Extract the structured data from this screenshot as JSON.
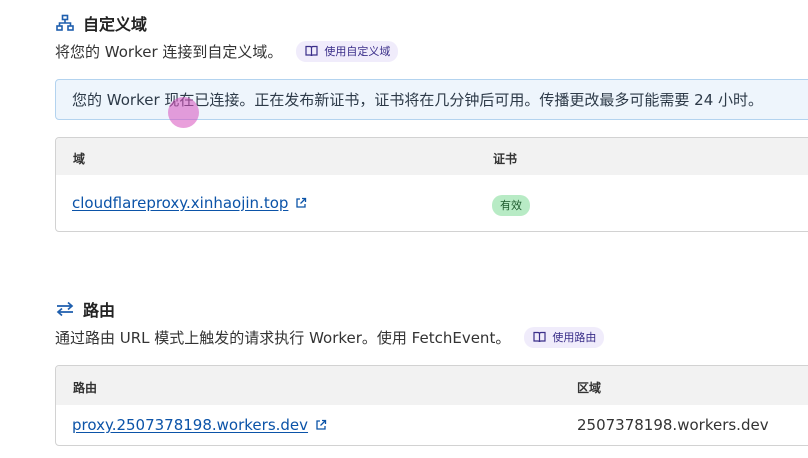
{
  "domains_section": {
    "title": "自定义域",
    "description": "将您的 Worker 连接到自定义域。",
    "docs_label": "使用自定义域",
    "banner": "您的 Worker 现在已连接。正在发布新证书，证书将在几分钟后可用。传播更改最多可能需要 24 小时。",
    "columns": [
      "域",
      "证书"
    ],
    "rows": [
      {
        "domain": "cloudflareproxy.xinhaojin.top",
        "certificate": "有效"
      }
    ]
  },
  "routes_section": {
    "title": "路由",
    "description": "通过路由 URL 模式上触发的请求执行 Worker。使用 FetchEvent。",
    "docs_label": "使用路由",
    "columns": [
      "路由",
      "区域"
    ],
    "rows": [
      {
        "route": "proxy.2507378198.workers.dev",
        "zone": "2507378198.workers.dev"
      }
    ]
  },
  "icons": {
    "domains": "sitemap-icon",
    "routes": "swap-arrows-icon",
    "docs": "book-icon",
    "external": "external-link-icon"
  },
  "colors": {
    "accent": "#0b53a8",
    "badge_bg": "#b8ebc5",
    "banner_bg": "#eef5fc",
    "banner_border": "#b3d3ef",
    "pill_bg": "#f0ecfb"
  }
}
